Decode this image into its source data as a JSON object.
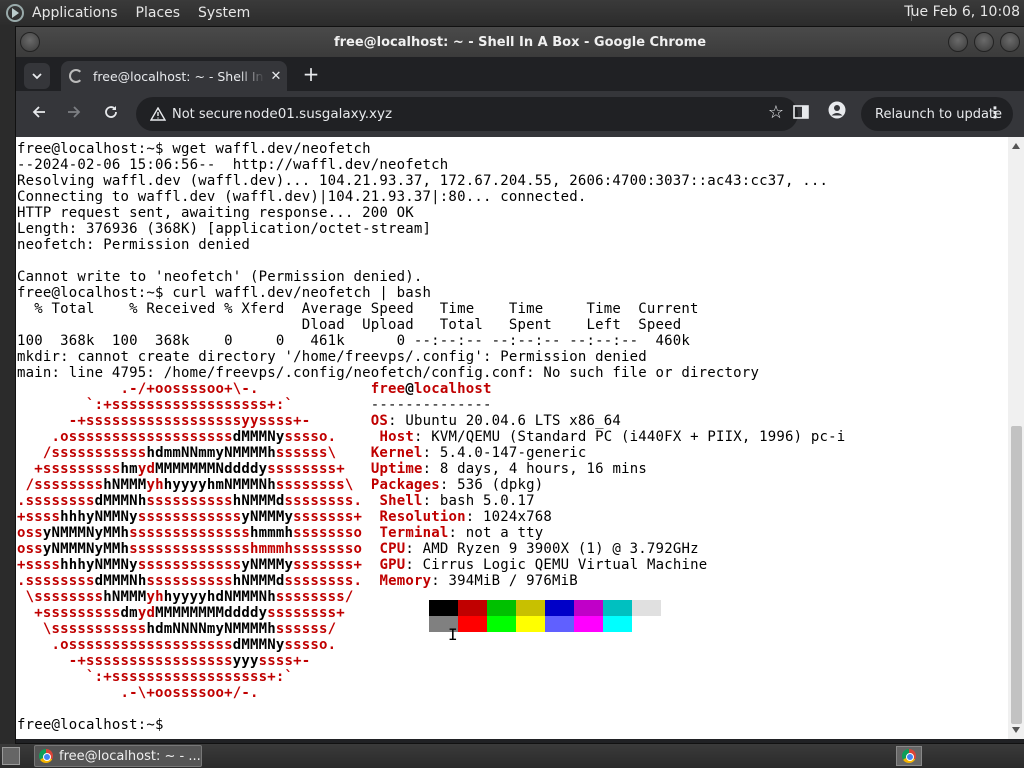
{
  "top_panel": {
    "menus": [
      "Applications",
      "Places",
      "System"
    ],
    "clock": "Tue Feb  6, 10:08"
  },
  "window": {
    "title": "free@localhost: ~ - Shell In A Box - Google Chrome"
  },
  "tab": {
    "title": "free@localhost: ~ - Shell In A Box"
  },
  "toolbar": {
    "security_label": "Not secure",
    "url": "node01.susgalaxy.xyz",
    "relaunch_label": "Relaunch to update"
  },
  "terminal": {
    "lines": [
      [
        {
          "t": "free@localhost:~$ wget waffl.dev/neofetch"
        }
      ],
      [
        {
          "t": "--2024-02-06 15:06:56--  http://waffl.dev/neofetch"
        }
      ],
      [
        {
          "t": "Resolving waffl.dev (waffl.dev)... 104.21.93.37, 172.67.204.55, 2606:4700:3037::ac43:cc37, ..."
        }
      ],
      [
        {
          "t": "Connecting to waffl.dev (waffl.dev)|104.21.93.37|:80... connected."
        }
      ],
      [
        {
          "t": "HTTP request sent, awaiting response... 200 OK"
        }
      ],
      [
        {
          "t": "Length: 376936 (368K) [application/octet-stream]"
        }
      ],
      [
        {
          "t": "neofetch: Permission denied"
        }
      ],
      [
        {
          "t": ""
        }
      ],
      [
        {
          "t": "Cannot write to 'neofetch' (Permission denied)."
        }
      ],
      [
        {
          "t": "free@localhost:~$ curl waffl.dev/neofetch | bash"
        }
      ],
      [
        {
          "t": "  % Total    % Received % Xferd  Average Speed   Time    Time     Time  Current"
        }
      ],
      [
        {
          "t": "                                 Dload  Upload   Total   Spent    Left  Speed"
        }
      ],
      [
        {
          "t": "100  368k  100  368k    0     0   461k      0 --:--:-- --:--:-- --:--:--  460k"
        }
      ],
      [
        {
          "t": "mkdir: cannot create directory '/home/freevps/.config': Permission denied"
        }
      ],
      [
        {
          "t": "main: line 4795: /home/freevps/.config/neofetch/config.conf: No such file or directory"
        }
      ],
      [
        {
          "t": "            .-/+oossssoo+\\-.",
          "c": "rb"
        },
        {
          "t": "             "
        },
        {
          "t": "free",
          "c": "rb"
        },
        {
          "t": "@",
          "c": "b"
        },
        {
          "t": "localhost",
          "c": "rb"
        }
      ],
      [
        {
          "t": "        `:+ssssssssssssssssss+:`",
          "c": "rb"
        },
        {
          "t": "         "
        },
        {
          "t": "--------------"
        }
      ],
      [
        {
          "t": "      -+ssssssssssssssssssyyssss+-",
          "c": "rb"
        },
        {
          "t": "       "
        },
        {
          "t": "OS",
          "c": "rb"
        },
        {
          "t": ": Ubuntu 20.04.6 LTS x86_64"
        }
      ],
      [
        {
          "t": "    .osssssssssssssssssss",
          "c": "rb"
        },
        {
          "t": "dMMMNy",
          "c": "b"
        },
        {
          "t": "sssso.",
          "c": "rb"
        },
        {
          "t": "     "
        },
        {
          "t": "Host",
          "c": "rb"
        },
        {
          "t": ": KVM/QEMU (Standard PC (i440FX + PIIX, 1996) pc-i"
        }
      ],
      [
        {
          "t": "   /sssssssssss",
          "c": "rb"
        },
        {
          "t": "hdmmNNmmyNMMMMh",
          "c": "b"
        },
        {
          "t": "ssssss\\",
          "c": "rb"
        },
        {
          "t": "    "
        },
        {
          "t": "Kernel",
          "c": "rb"
        },
        {
          "t": ": 5.4.0-147-generic"
        }
      ],
      [
        {
          "t": "  +sssssssss",
          "c": "rb"
        },
        {
          "t": "hm",
          "c": "b"
        },
        {
          "t": "yd",
          "c": "rb"
        },
        {
          "t": "MMMMMMMNddddy",
          "c": "b"
        },
        {
          "t": "ssssssss+",
          "c": "rb"
        },
        {
          "t": "   "
        },
        {
          "t": "Uptime",
          "c": "rb"
        },
        {
          "t": ": 8 days, 4 hours, 16 mins"
        }
      ],
      [
        {
          "t": " /ssssssss",
          "c": "rb"
        },
        {
          "t": "hNMMM",
          "c": "b"
        },
        {
          "t": "yh",
          "c": "rb"
        },
        {
          "t": "hyyyyhmNMMMNh",
          "c": "b"
        },
        {
          "t": "ssssssss\\",
          "c": "rb"
        },
        {
          "t": "  "
        },
        {
          "t": "Packages",
          "c": "rb"
        },
        {
          "t": ": 536 (dpkg)"
        }
      ],
      [
        {
          "t": ".ssssssss",
          "c": "rb"
        },
        {
          "t": "dMMMNh",
          "c": "b"
        },
        {
          "t": "ssssssssss",
          "c": "rb"
        },
        {
          "t": "hNMMMd",
          "c": "b"
        },
        {
          "t": "ssssssss.",
          "c": "rb"
        },
        {
          "t": "  "
        },
        {
          "t": "Shell",
          "c": "rb"
        },
        {
          "t": ": bash 5.0.17"
        }
      ],
      [
        {
          "t": "+ssss",
          "c": "rb"
        },
        {
          "t": "hhhyNMMNy",
          "c": "b"
        },
        {
          "t": "ssssssssssss",
          "c": "rb"
        },
        {
          "t": "yNMMMy",
          "c": "b"
        },
        {
          "t": "sssssss+",
          "c": "rb"
        },
        {
          "t": "  "
        },
        {
          "t": "Resolution",
          "c": "rb"
        },
        {
          "t": ": 1024x768"
        }
      ],
      [
        {
          "t": "oss",
          "c": "rb"
        },
        {
          "t": "yNMMMNyMMh",
          "c": "b"
        },
        {
          "t": "ssssssssssssss",
          "c": "rb"
        },
        {
          "t": "hmmmh",
          "c": "b"
        },
        {
          "t": "ssssssso",
          "c": "rb"
        },
        {
          "t": "  "
        },
        {
          "t": "Terminal",
          "c": "rb"
        },
        {
          "t": ": not a tty"
        }
      ],
      [
        {
          "t": "oss",
          "c": "rb"
        },
        {
          "t": "yNMMMNyMMh",
          "c": "b"
        },
        {
          "t": "sssssssssssssshmmmhssssssso",
          "c": "rb"
        },
        {
          "t": "  "
        },
        {
          "t": "CPU",
          "c": "rb"
        },
        {
          "t": ": AMD Ryzen 9 3900X (1) @ 3.792GHz"
        }
      ],
      [
        {
          "t": "+ssss",
          "c": "rb"
        },
        {
          "t": "hhhyNMMNy",
          "c": "b"
        },
        {
          "t": "ssssssssssss",
          "c": "rb"
        },
        {
          "t": "yNMMMy",
          "c": "b"
        },
        {
          "t": "sssssss+",
          "c": "rb"
        },
        {
          "t": "  "
        },
        {
          "t": "GPU",
          "c": "rb"
        },
        {
          "t": ": Cirrus Logic QEMU Virtual Machine"
        }
      ],
      [
        {
          "t": ".ssssssss",
          "c": "rb"
        },
        {
          "t": "dMMMNh",
          "c": "b"
        },
        {
          "t": "ssssssssss",
          "c": "rb"
        },
        {
          "t": "hNMMMd",
          "c": "b"
        },
        {
          "t": "ssssssss.",
          "c": "rb"
        },
        {
          "t": "  "
        },
        {
          "t": "Memory",
          "c": "rb"
        },
        {
          "t": ": 394MiB / 976MiB"
        }
      ],
      [
        {
          "t": " \\ssssssss",
          "c": "rb"
        },
        {
          "t": "hNMMM",
          "c": "b"
        },
        {
          "t": "yh",
          "c": "rb"
        },
        {
          "t": "hyyyyhdNMMMNh",
          "c": "b"
        },
        {
          "t": "ssssssss/",
          "c": "rb"
        }
      ],
      [
        {
          "t": "  +sssssssss",
          "c": "rb"
        },
        {
          "t": "dm",
          "c": "b"
        },
        {
          "t": "yd",
          "c": "rb"
        },
        {
          "t": "MMMMMMMMddddy",
          "c": "b"
        },
        {
          "t": "ssssssss+",
          "c": "rb"
        }
      ],
      [
        {
          "t": "   \\sssssssssss",
          "c": "rb"
        },
        {
          "t": "hdmNNNNmyNMMMMh",
          "c": "b"
        },
        {
          "t": "ssssss/",
          "c": "rb"
        }
      ],
      [
        {
          "t": "    .osssssssssssssssssss",
          "c": "rb"
        },
        {
          "t": "dMMMNy",
          "c": "b"
        },
        {
          "t": "sssso.",
          "c": "rb"
        }
      ],
      [
        {
          "t": "      -+sssssssssssssssss",
          "c": "rb"
        },
        {
          "t": "yyy",
          "c": "b"
        },
        {
          "t": "ssss+-",
          "c": "rb"
        }
      ],
      [
        {
          "t": "        `:+ssssssssssssssssss+:`",
          "c": "rb"
        }
      ],
      [
        {
          "t": "            .-\\+oossssoo+/-.",
          "c": "rb"
        }
      ],
      [
        {
          "t": ""
        }
      ],
      [
        {
          "t": "free@localhost:~$ "
        }
      ]
    ],
    "color_row1": [
      "#000000",
      "#c00000",
      "#00c000",
      "#c8c000",
      "#0000c8",
      "#c000c8",
      "#00c0c0",
      "#e0e0e0"
    ],
    "color_row2": [
      "#808080",
      "#ff0000",
      "#00ff00",
      "#ffff00",
      "#6060ff",
      "#ff00ff",
      "#00ffff",
      "#ffffff"
    ]
  },
  "taskbar": {
    "task_label": "free@localhost: ~ - ..."
  }
}
